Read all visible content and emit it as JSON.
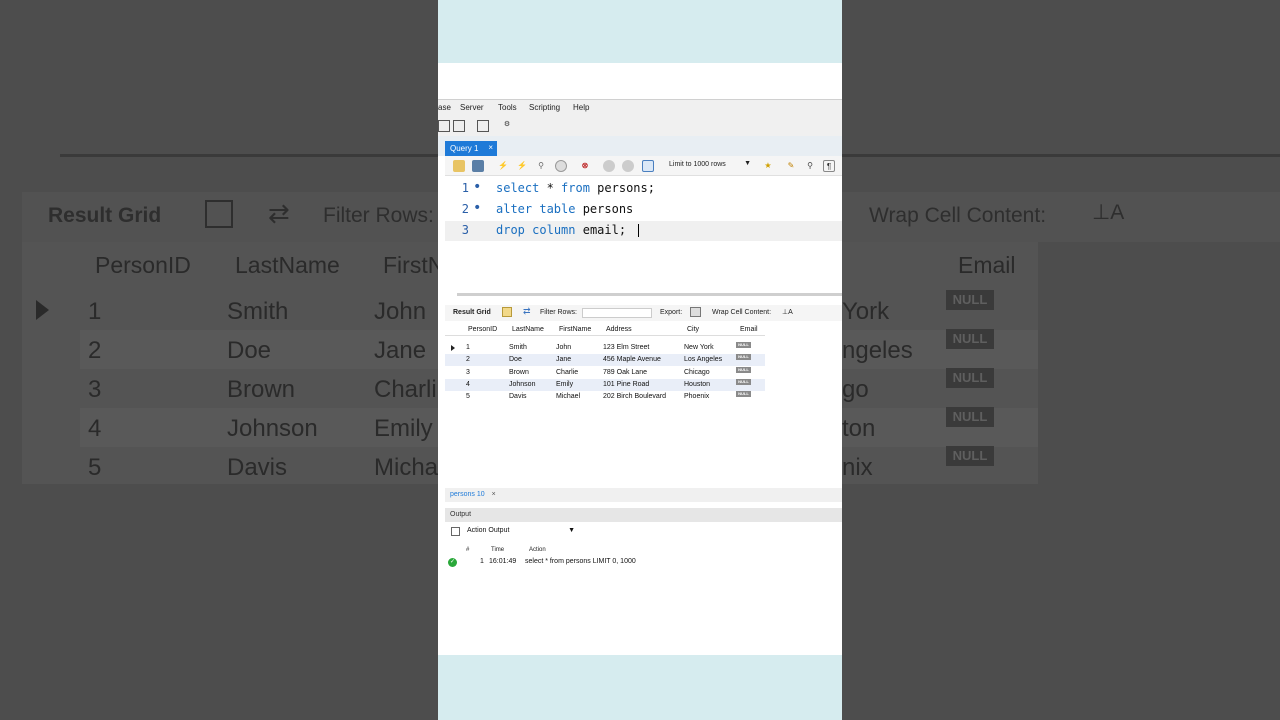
{
  "background": {
    "toolbar": {
      "result_grid": "Result Grid",
      "filter_rows": "Filter Rows:",
      "wrap_cell_content": "Wrap Cell Content:"
    },
    "columns": [
      "PersonID",
      "LastName",
      "FirstN",
      "Email"
    ],
    "rows": [
      {
        "id": "1",
        "last": "Smith",
        "first": "John",
        "city": "York",
        "email": "NULL"
      },
      {
        "id": "2",
        "last": "Doe",
        "first": "Jane",
        "city": "ngeles",
        "email": "NULL"
      },
      {
        "id": "3",
        "last": "Brown",
        "first": "Charli",
        "city": "go",
        "email": "NULL"
      },
      {
        "id": "4",
        "last": "Johnson",
        "first": "Emily",
        "city": "ton",
        "email": "NULL"
      },
      {
        "id": "5",
        "last": "Davis",
        "first": "Micha",
        "city": "nix",
        "email": "NULL"
      }
    ]
  },
  "menu": {
    "items": [
      "ase",
      "Server",
      "Tools",
      "Scripting",
      "Help"
    ]
  },
  "query_tab": {
    "label": "Query 1",
    "close": "×"
  },
  "editor_toolbar": {
    "limit_label": "Limit to 1000 rows"
  },
  "editor": {
    "lines": [
      {
        "num": "1",
        "kw1": "select",
        "t1": " * ",
        "kw2": "from",
        "t2": " persons;"
      },
      {
        "num": "2",
        "kw1": "alter",
        "t1": " ",
        "kw2": "table",
        "t2": " persons"
      },
      {
        "num": "3",
        "kw1": "drop",
        "t1": " ",
        "kw2": "column",
        "t2": " email;"
      }
    ]
  },
  "result_toolbar": {
    "result_grid": "Result Grid",
    "filter_rows": "Filter Rows:",
    "export": "Export:",
    "wrap_cell_content": "Wrap Cell Content:"
  },
  "grid": {
    "columns": [
      "PersonID",
      "LastName",
      "FirstName",
      "Address",
      "City",
      "Email"
    ],
    "rows": [
      {
        "id": "1",
        "last": "Smith",
        "first": "John",
        "address": "123 Elm Street",
        "city": "New York",
        "email": "NULL"
      },
      {
        "id": "2",
        "last": "Doe",
        "first": "Jane",
        "address": "456 Maple Avenue",
        "city": "Los Angeles",
        "email": "NULL"
      },
      {
        "id": "3",
        "last": "Brown",
        "first": "Charlie",
        "address": "789 Oak Lane",
        "city": "Chicago",
        "email": "NULL"
      },
      {
        "id": "4",
        "last": "Johnson",
        "first": "Emily",
        "address": "101 Pine Road",
        "city": "Houston",
        "email": "NULL"
      },
      {
        "id": "5",
        "last": "Davis",
        "first": "Michael",
        "address": "202 Birch Boulevard",
        "city": "Phoenix",
        "email": "NULL"
      }
    ]
  },
  "result_tab": {
    "label": "persons 10",
    "close": "×"
  },
  "output": {
    "header": "Output",
    "select_label": "Action Output",
    "columns": [
      "#",
      "Time",
      "Action"
    ],
    "entries": [
      {
        "num": "1",
        "time": "16:01:49",
        "action": "select * from persons LIMIT 0, 1000"
      }
    ]
  }
}
